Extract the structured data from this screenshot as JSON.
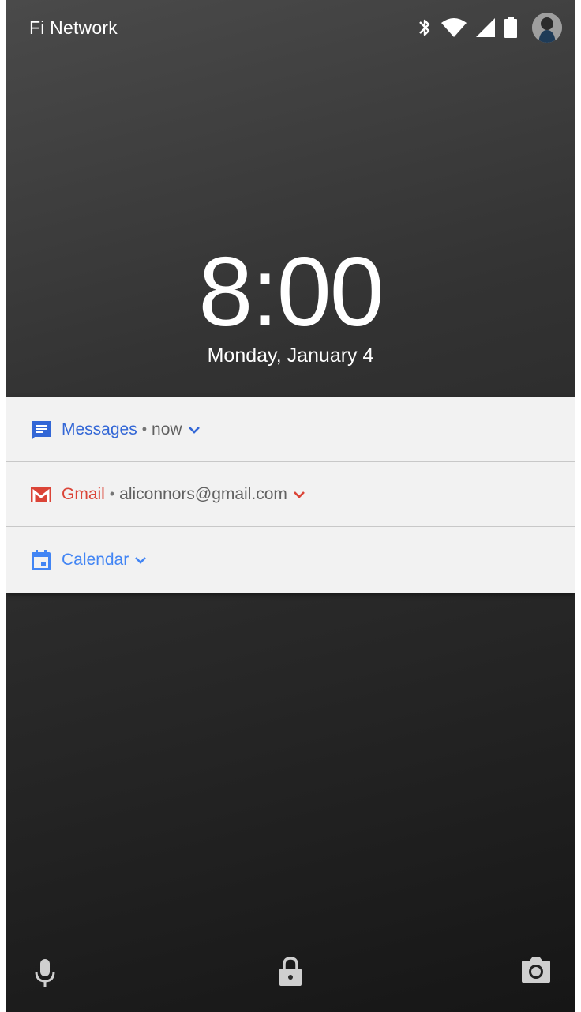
{
  "status_bar": {
    "carrier": "Fi Network",
    "icons": [
      "bluetooth-icon",
      "wifi-icon",
      "cell-signal-icon",
      "battery-icon",
      "avatar"
    ]
  },
  "lockscreen": {
    "time": "8:00",
    "date": "Monday, January 4"
  },
  "notifications": [
    {
      "app": "Messages",
      "separator": "•",
      "detail": "now",
      "icon": "messages-icon",
      "color": "#3367d6"
    },
    {
      "app": "Gmail",
      "separator": "•",
      "detail": "aliconnors@gmail.com",
      "icon": "gmail-icon",
      "color": "#db4437"
    },
    {
      "app": "Calendar",
      "icon": "calendar-icon",
      "color": "#4285f4"
    }
  ],
  "bottom_actions": [
    "mic-icon",
    "lock-icon",
    "camera-icon"
  ],
  "colors": {
    "background_top": "#4a4a4a",
    "background_bottom": "#161616",
    "notification_bg": "#f2f2f2"
  }
}
